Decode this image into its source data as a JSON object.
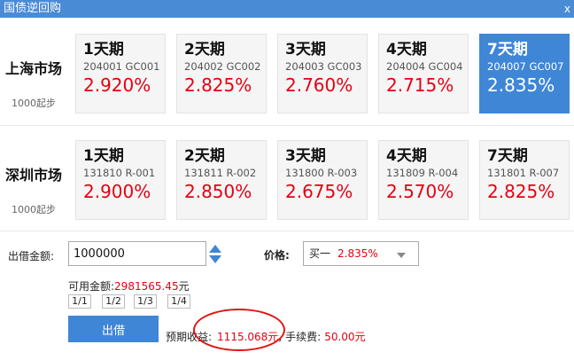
{
  "window": {
    "title": "国债逆回购",
    "close_glyph": "x"
  },
  "markets": [
    {
      "name": "上海市场",
      "min": "1000起步",
      "products": [
        {
          "term": "1天期",
          "codes": "204001 GC001",
          "rate": "2.920%"
        },
        {
          "term": "2天期",
          "codes": "204002 GC002",
          "rate": "2.825%"
        },
        {
          "term": "3天期",
          "codes": "204003 GC003",
          "rate": "2.760%"
        },
        {
          "term": "4天期",
          "codes": "204004 GC004",
          "rate": "2.715%"
        },
        {
          "term": "7天期",
          "codes": "204007 GC007",
          "rate": "2.835%"
        }
      ]
    },
    {
      "name": "深圳市场",
      "min": "1000起步",
      "products": [
        {
          "term": "1天期",
          "codes": "131810 R-001",
          "rate": "2.900%"
        },
        {
          "term": "2天期",
          "codes": "131811 R-002",
          "rate": "2.850%"
        },
        {
          "term": "3天期",
          "codes": "131800 R-003",
          "rate": "2.675%"
        },
        {
          "term": "4天期",
          "codes": "131809 R-004",
          "rate": "2.570%"
        },
        {
          "term": "7天期",
          "codes": "131801 R-007",
          "rate": "2.825%"
        }
      ]
    }
  ],
  "form": {
    "amount_label": "出借金额:",
    "amount_value": "1000000",
    "price_label": "价格:",
    "price_direction": "买一",
    "price_value": "2.835%",
    "available_label": "可用金额:",
    "available_value": "2981565.45",
    "available_unit": "元",
    "fractions": [
      "1/1",
      "1/2",
      "1/3",
      "1/4"
    ],
    "submit_label": "出借",
    "expected_label": "预期收益:",
    "expected_value": "1115.068元",
    "expected_sep": ",",
    "fee_label": "手续费:",
    "fee_value": "50.00元"
  },
  "colors": {
    "accent": "#3f86d6",
    "titlebar": "#4a8bd6",
    "rate_red": "#e60012",
    "annotation": "#e01515"
  }
}
